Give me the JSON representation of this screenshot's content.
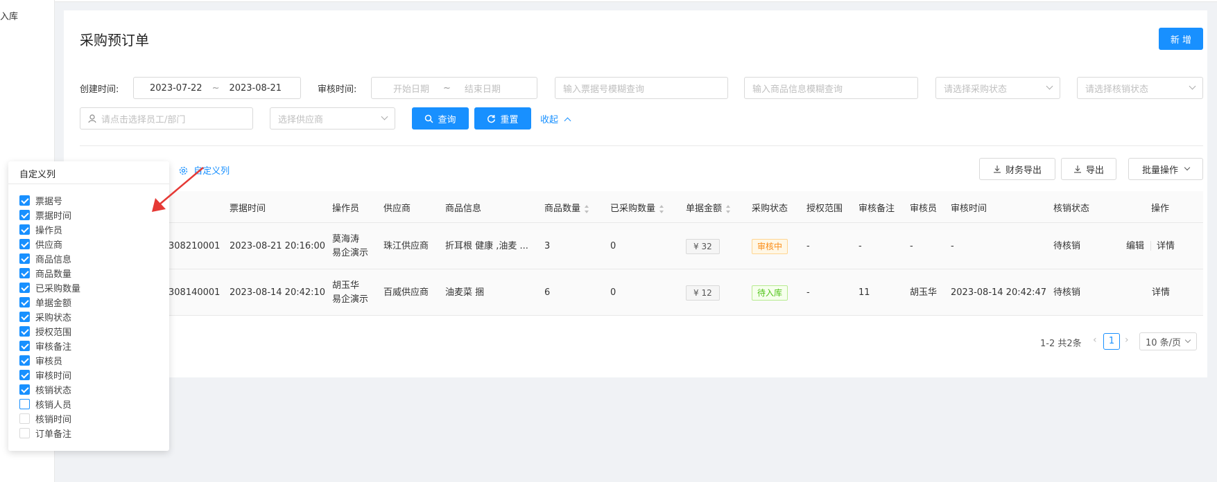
{
  "nav": {
    "partial_item": "入库"
  },
  "page": {
    "title": "采购预订单",
    "add_button": "新 增"
  },
  "filters": {
    "create_time_label": "创建时间:",
    "create_start": "2023-07-22",
    "create_end": "2023-08-21",
    "audit_time_label": "审核时间:",
    "audit_start_placeholder": "开始日期",
    "audit_end_placeholder": "结束日期",
    "range_sep": "~",
    "doc_no_placeholder": "输入票据号模糊查询",
    "goods_placeholder": "输入商品信息模糊查询",
    "purchase_status_placeholder": "请选择采购状态",
    "writeoff_status_placeholder": "请选择核销状态",
    "staff_placeholder": "请点击选择员工/部门",
    "supplier_placeholder": "选择供应商",
    "query_button": "查询",
    "reset_button": "重置",
    "collapse_link": "收起"
  },
  "toolbar": {
    "custom_columns_link": "自定义列",
    "finance_export": "财务导出",
    "export": "导出",
    "batch_ops": "批量操作"
  },
  "table": {
    "headers": {
      "doc_time": "票据时间",
      "operator": "操作员",
      "supplier": "供应商",
      "goods": "商品信息",
      "qty": "商品数量",
      "purchased_qty": "已采购数量",
      "amount": "单据金额",
      "status": "采购状态",
      "scope": "授权范围",
      "audit_note": "审核备注",
      "auditor": "审核员",
      "audit_time": "审核时间",
      "writeoff_status": "核销状态",
      "actions": "操作"
    },
    "rows": [
      {
        "doc_no": "308210001",
        "doc_time": "2023-08-21 20:16:00",
        "operator_name": "莫海涛",
        "operator_org": "易企演示",
        "supplier": "珠江供应商",
        "goods": "折耳根 健康 ,油麦 ...",
        "qty": "3",
        "purchased_qty": "0",
        "amount": "¥ 32",
        "status": "审核中",
        "scope": "-",
        "audit_note": "-",
        "auditor": "-",
        "audit_time": "-",
        "writeoff_status": "待核销",
        "edit": "编辑",
        "detail": "详情"
      },
      {
        "doc_no": "308140001",
        "doc_time": "2023-08-14 20:42:10",
        "operator_name": "胡玉华",
        "operator_org": "易企演示",
        "supplier": "百威供应商",
        "goods": "油麦菜 捆",
        "qty": "6",
        "purchased_qty": "0",
        "amount": "¥ 12",
        "status": "待入库",
        "scope": "-",
        "audit_note": "11",
        "auditor": "胡玉华",
        "audit_time": "2023-08-14 20:42:47",
        "writeoff_status": "待核销",
        "detail": "详情"
      }
    ]
  },
  "pagination": {
    "summary": "1-2 共2条",
    "current": "1",
    "page_size": "10 条/页"
  },
  "column_popover": {
    "title": "自定义列",
    "items": [
      {
        "label": "票据号",
        "checked": true
      },
      {
        "label": "票据时间",
        "checked": true
      },
      {
        "label": "操作员",
        "checked": true
      },
      {
        "label": "供应商",
        "checked": true
      },
      {
        "label": "商品信息",
        "checked": true
      },
      {
        "label": "商品数量",
        "checked": true
      },
      {
        "label": "已采购数量",
        "checked": true
      },
      {
        "label": "单据金额",
        "checked": true
      },
      {
        "label": "采购状态",
        "checked": true
      },
      {
        "label": "授权范围",
        "checked": true
      },
      {
        "label": "审核备注",
        "checked": true
      },
      {
        "label": "审核员",
        "checked": true
      },
      {
        "label": "审核时间",
        "checked": true
      },
      {
        "label": "核销状态",
        "checked": true
      },
      {
        "label": "核销人员",
        "checked": false
      },
      {
        "label": "核销时间",
        "checked": false
      },
      {
        "label": "订单备注",
        "checked": false
      }
    ]
  },
  "colors": {
    "primary": "#1890ff",
    "orange": "#fa8c16",
    "green": "#52c41a",
    "annotation_arrow": "#e53935"
  }
}
